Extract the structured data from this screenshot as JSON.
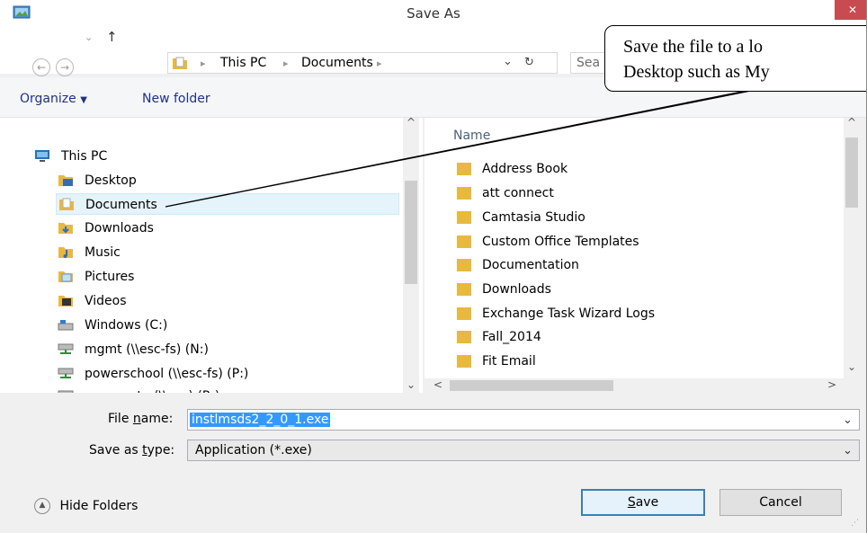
{
  "window": {
    "title": "Save As"
  },
  "address": {
    "crumbs": [
      "This PC",
      "Documents"
    ],
    "search_placeholder": "Sea"
  },
  "toolbar": {
    "organize_label": "Organize",
    "new_folder_label": "New folder"
  },
  "nav": {
    "items": [
      {
        "label": "This PC",
        "icon": "computer-icon"
      },
      {
        "label": "Desktop",
        "icon": "desktop-folder-icon"
      },
      {
        "label": "Documents",
        "icon": "documents-folder-icon",
        "selected": true
      },
      {
        "label": "Downloads",
        "icon": "downloads-folder-icon"
      },
      {
        "label": "Music",
        "icon": "music-folder-icon"
      },
      {
        "label": "Pictures",
        "icon": "pictures-folder-icon"
      },
      {
        "label": "Videos",
        "icon": "videos-folder-icon"
      },
      {
        "label": "Windows (C:)",
        "icon": "drive-icon"
      },
      {
        "label": "mgmt (\\\\esc-fs) (N:)",
        "icon": "network-drive-icon"
      },
      {
        "label": "powerschool (\\\\esc-fs) (P:)",
        "icon": "network-drive-icon"
      },
      {
        "label": "roommate (\\\\esc) (R:)",
        "icon": "network-drive-icon"
      }
    ]
  },
  "files": {
    "column_name": "Name",
    "items": [
      "Address Book",
      "att connect",
      "Camtasia Studio",
      "Custom Office Templates",
      "Documentation",
      "Downloads",
      "Exchange Task Wizard Logs",
      "Fall_2014",
      "Fit Email"
    ]
  },
  "form": {
    "file_name_label_pre": "File ",
    "file_name_label_key": "n",
    "file_name_label_post": "ame:",
    "file_name_value": "instlmsds2_2_0_1.exe",
    "save_type_label_pre": "Save as ",
    "save_type_label_key": "t",
    "save_type_label_post": "ype:",
    "save_type_value": "Application (*.exe)"
  },
  "footer": {
    "hide_folders_label": "Hide Folders",
    "save_label_key": "S",
    "save_label_rest": "ave",
    "cancel_label": "Cancel"
  },
  "callout": {
    "line1": "Save the file to a lo",
    "line2": "Desktop such as My"
  },
  "colors": {
    "folder": "#e8b93c",
    "selection": "#3399ff",
    "nav_selected": "#e5f3fb",
    "close_button": "#c74b50"
  }
}
